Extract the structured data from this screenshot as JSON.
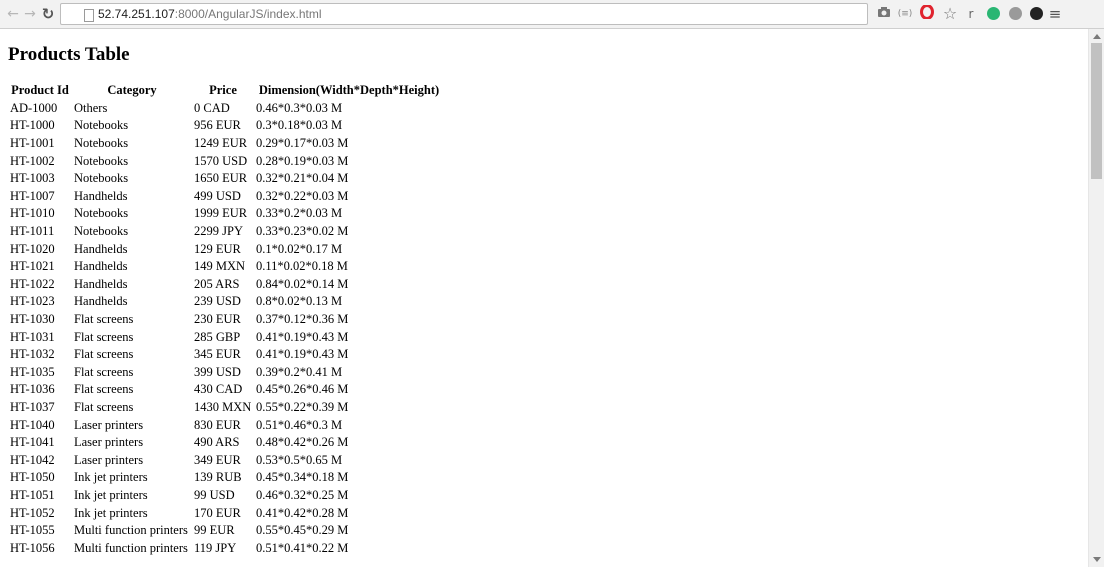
{
  "browser": {
    "url_host": "52.74.251.107",
    "url_rest": ":8000/AngularJS/index.html",
    "back_icon": "arrow-left-icon",
    "forward_icon": "arrow-right-icon",
    "reload_icon": "reload-icon",
    "ext_r_label": "r",
    "accent_green": "#2ab673",
    "accent_red": "#e0232e"
  },
  "page": {
    "title": "Products Table"
  },
  "table": {
    "headers": {
      "product_id": "Product Id",
      "category": "Category",
      "price": "Price",
      "dimension": "Dimension(Width*Depth*Height)"
    },
    "rows": [
      [
        "AD-1000",
        "Others",
        "0 CAD",
        "0.46*0.3*0.03 M"
      ],
      [
        "HT-1000",
        "Notebooks",
        "956 EUR",
        "0.3*0.18*0.03 M"
      ],
      [
        "HT-1001",
        "Notebooks",
        "1249 EUR",
        "0.29*0.17*0.03 M"
      ],
      [
        "HT-1002",
        "Notebooks",
        "1570 USD",
        "0.28*0.19*0.03 M"
      ],
      [
        "HT-1003",
        "Notebooks",
        "1650 EUR",
        "0.32*0.21*0.04 M"
      ],
      [
        "HT-1007",
        "Handhelds",
        "499 USD",
        "0.32*0.22*0.03 M"
      ],
      [
        "HT-1010",
        "Notebooks",
        "1999 EUR",
        "0.33*0.2*0.03 M"
      ],
      [
        "HT-1011",
        "Notebooks",
        "2299 JPY",
        "0.33*0.23*0.02 M"
      ],
      [
        "HT-1020",
        "Handhelds",
        "129 EUR",
        "0.1*0.02*0.17 M"
      ],
      [
        "HT-1021",
        "Handhelds",
        "149 MXN",
        "0.11*0.02*0.18 M"
      ],
      [
        "HT-1022",
        "Handhelds",
        "205 ARS",
        "0.84*0.02*0.14 M"
      ],
      [
        "HT-1023",
        "Handhelds",
        "239 USD",
        "0.8*0.02*0.13 M"
      ],
      [
        "HT-1030",
        "Flat screens",
        "230 EUR",
        "0.37*0.12*0.36 M"
      ],
      [
        "HT-1031",
        "Flat screens",
        "285 GBP",
        "0.41*0.19*0.43 M"
      ],
      [
        "HT-1032",
        "Flat screens",
        "345 EUR",
        "0.41*0.19*0.43 M"
      ],
      [
        "HT-1035",
        "Flat screens",
        "399 USD",
        "0.39*0.2*0.41 M"
      ],
      [
        "HT-1036",
        "Flat screens",
        "430 CAD",
        "0.45*0.26*0.46 M"
      ],
      [
        "HT-1037",
        "Flat screens",
        "1430 MXN",
        "0.55*0.22*0.39 M"
      ],
      [
        "HT-1040",
        "Laser printers",
        "830 EUR",
        "0.51*0.46*0.3 M"
      ],
      [
        "HT-1041",
        "Laser printers",
        "490 ARS",
        "0.48*0.42*0.26 M"
      ],
      [
        "HT-1042",
        "Laser printers",
        "349 EUR",
        "0.53*0.5*0.65 M"
      ],
      [
        "HT-1050",
        "Ink jet printers",
        "139 RUB",
        "0.45*0.34*0.18 M"
      ],
      [
        "HT-1051",
        "Ink jet printers",
        "99 USD",
        "0.46*0.32*0.25 M"
      ],
      [
        "HT-1052",
        "Ink jet printers",
        "170 EUR",
        "0.41*0.42*0.28 M"
      ],
      [
        "HT-1055",
        "Multi function printers",
        "99 EUR",
        "0.55*0.45*0.29 M"
      ],
      [
        "HT-1056",
        "Multi function printers",
        "119 JPY",
        "0.51*0.41*0.22 M"
      ]
    ]
  }
}
